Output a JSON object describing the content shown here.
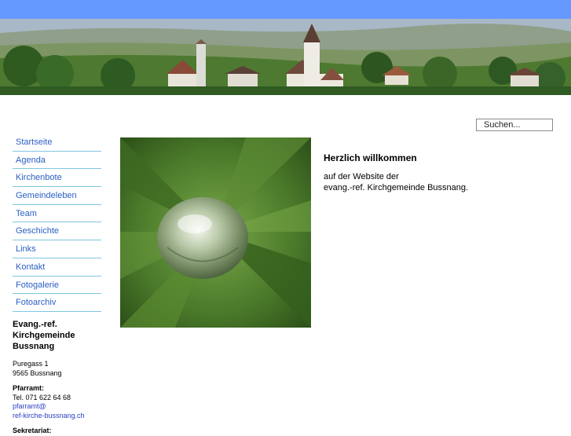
{
  "search": {
    "placeholder": "Suchen..."
  },
  "nav": {
    "items": [
      {
        "label": "Startseite"
      },
      {
        "label": "Agenda"
      },
      {
        "label": "Kirchenbote"
      },
      {
        "label": "Gemeindeleben"
      },
      {
        "label": "Team"
      },
      {
        "label": "Geschichte"
      },
      {
        "label": "Links"
      },
      {
        "label": "Kontakt"
      },
      {
        "label": "Fotogalerie"
      },
      {
        "label": "Fotoarchiv"
      }
    ]
  },
  "address": {
    "org_line1": "Evang.-ref.",
    "org_line2": "Kirchgemeinde Bussnang",
    "street": "Puregass 1",
    "city": "9565 Bussnang",
    "pfarramt_heading": "Pfarramt:",
    "phone": "Tel. 071 622 64 68",
    "email_line1": "pfarramt@",
    "email_line2": "ref-kirche-bussnang.ch",
    "sekretariat_heading": "Sekretariat:"
  },
  "welcome": {
    "title": "Herzlich willkommen",
    "line1": "auf der Website der",
    "line2": "evang.-ref. Kirchgemeinde Bussnang."
  },
  "colors": {
    "topbar": "#6699ff",
    "nav_link": "#2a5fc4",
    "nav_divider": "#7fc6e0"
  }
}
